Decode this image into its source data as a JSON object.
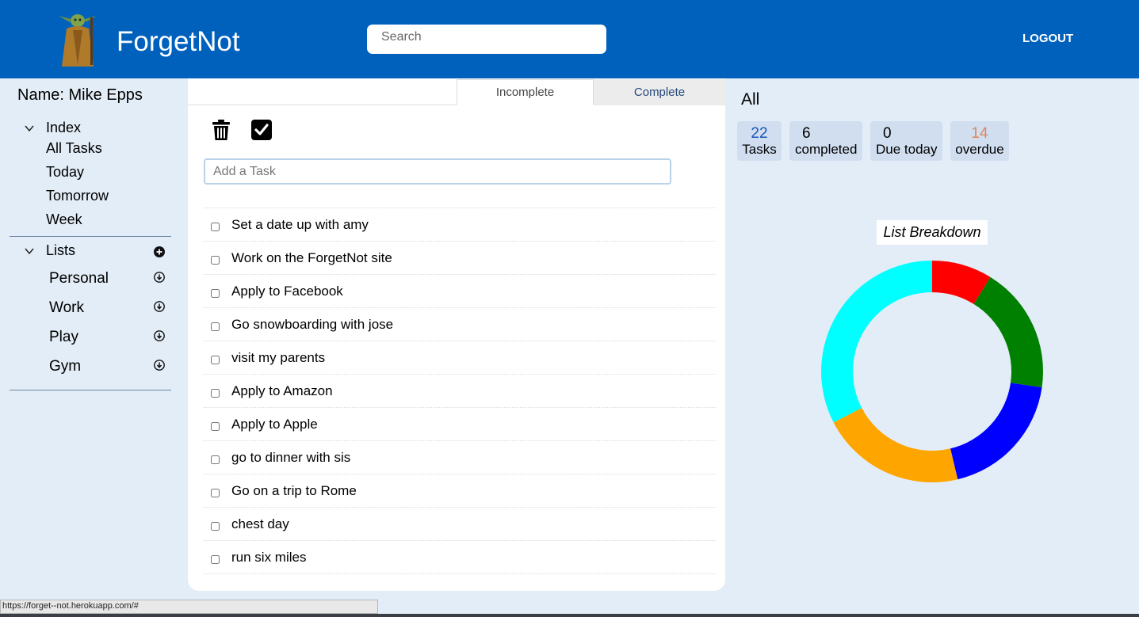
{
  "header": {
    "brand": "ForgetNot",
    "search_placeholder": "Search",
    "logout": "LOGOUT",
    "colors": {
      "bar": "#0061bd"
    }
  },
  "sidebar": {
    "username": "Name: Mike Epps",
    "index": {
      "label": "Index",
      "items": [
        "All Tasks",
        "Today",
        "Tomorrow",
        "Week"
      ]
    },
    "lists": {
      "label": "Lists",
      "items": [
        "Personal",
        "Work",
        "Play",
        "Gym"
      ]
    }
  },
  "tasks_panel": {
    "tabs": {
      "incomplete": "Incomplete",
      "complete": "Complete"
    },
    "add_placeholder": "Add a Task",
    "tasks": [
      "Set a date up with amy",
      "Work on the ForgetNot site",
      "Apply to Facebook",
      "Go snowboarding with jose",
      "visit my parents",
      "Apply to Amazon",
      "Apply to Apple",
      "go to dinner with sis",
      "Go on a trip to Rome",
      "chest day",
      "run six miles"
    ]
  },
  "summary": {
    "title": "All",
    "stats": {
      "tasks": {
        "value": "22",
        "label": "Tasks",
        "color": "#1a56b8"
      },
      "completed": {
        "value": "6",
        "label": "completed",
        "color": "#000000"
      },
      "due_today": {
        "value": "0",
        "label": "Due today",
        "color": "#000000"
      },
      "overdue": {
        "value": "14",
        "label": "overdue",
        "color": "#e0855a"
      }
    }
  },
  "chart_data": {
    "type": "pie",
    "title": "List Breakdown",
    "donut": true,
    "slices": [
      {
        "color": "#ff0000",
        "value": 8.8
      },
      {
        "color": "#008000",
        "value": 18.5
      },
      {
        "color": "#0000ff",
        "value": 19.0
      },
      {
        "color": "#ffa500",
        "value": 21.1
      },
      {
        "color": "#00ffff",
        "value": 32.6
      }
    ]
  },
  "statusbar": {
    "url": "https://forget--not.herokuapp.com/#"
  }
}
